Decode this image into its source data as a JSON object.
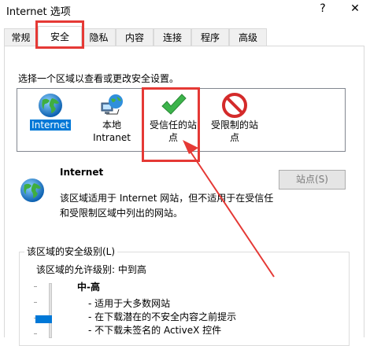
{
  "window": {
    "title": "Internet 选项",
    "help_label": "?",
    "close_label": "✕"
  },
  "tabs": [
    {
      "label": "常规",
      "active": false
    },
    {
      "label": "安全",
      "active": true
    },
    {
      "label": "隐私",
      "active": false
    },
    {
      "label": "内容",
      "active": false
    },
    {
      "label": "连接",
      "active": false
    },
    {
      "label": "程序",
      "active": false
    },
    {
      "label": "高级",
      "active": false
    }
  ],
  "security": {
    "prompt": "选择一个区域以查看或更改安全设置。",
    "zones": [
      {
        "label": "Internet",
        "icon": "globe-icon",
        "selected": true
      },
      {
        "label_line1": "本地",
        "label_line2": "Intranet",
        "icon": "network-globe-icon"
      },
      {
        "label_line1": "受信任的站",
        "label_line2": "点",
        "icon": "checkmark-icon"
      },
      {
        "label_line1": "受限制的站",
        "label_line2": "点",
        "icon": "restricted-icon"
      }
    ],
    "info": {
      "title": "Internet",
      "description": "该区域适用于 Internet 网站，但不适用于在受信任和受限制区域中列出的网站。"
    },
    "sites_button": "站点(S)",
    "level_group": {
      "title": "该区域的安全级别(L)",
      "allowed": "该区域的允许级别: 中到高",
      "level": "中-高",
      "bullets": [
        "- 适用于大多数网站",
        "- 在下载潜在的不安全内容之前提示",
        "- 不下载未签名的 ActiveX 控件"
      ]
    }
  },
  "colors": {
    "highlight": "#0078d7",
    "annotation_red": "#e53935",
    "check_green": "#3cb44b"
  }
}
